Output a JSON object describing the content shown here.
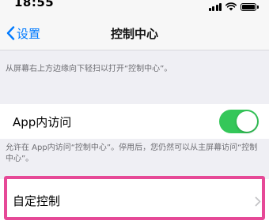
{
  "status_bar": {
    "time": "18:55"
  },
  "nav": {
    "back_label": "设置",
    "title": "控制中心"
  },
  "description": "从屏幕右上方边缘向下轻扫以打开“控制中心”。",
  "access_within_apps": {
    "label": "App内访问",
    "enabled": true,
    "footer": "允许在 App内访问“控制中心”。停用后，您仍然可以从主屏幕访问“控制中心”。"
  },
  "customize_controls": {
    "label": "自定控制"
  },
  "colors": {
    "accent_blue": "#007aff",
    "toggle_on": "#34c759",
    "highlight": "#e64997",
    "grouped_bg": "#efeff4"
  },
  "icons": {
    "back": "chevron-left-icon",
    "disclosure": "chevron-right-icon",
    "signal": "cellular-signal-icon",
    "wifi": "wifi-icon",
    "battery": "battery-icon"
  }
}
